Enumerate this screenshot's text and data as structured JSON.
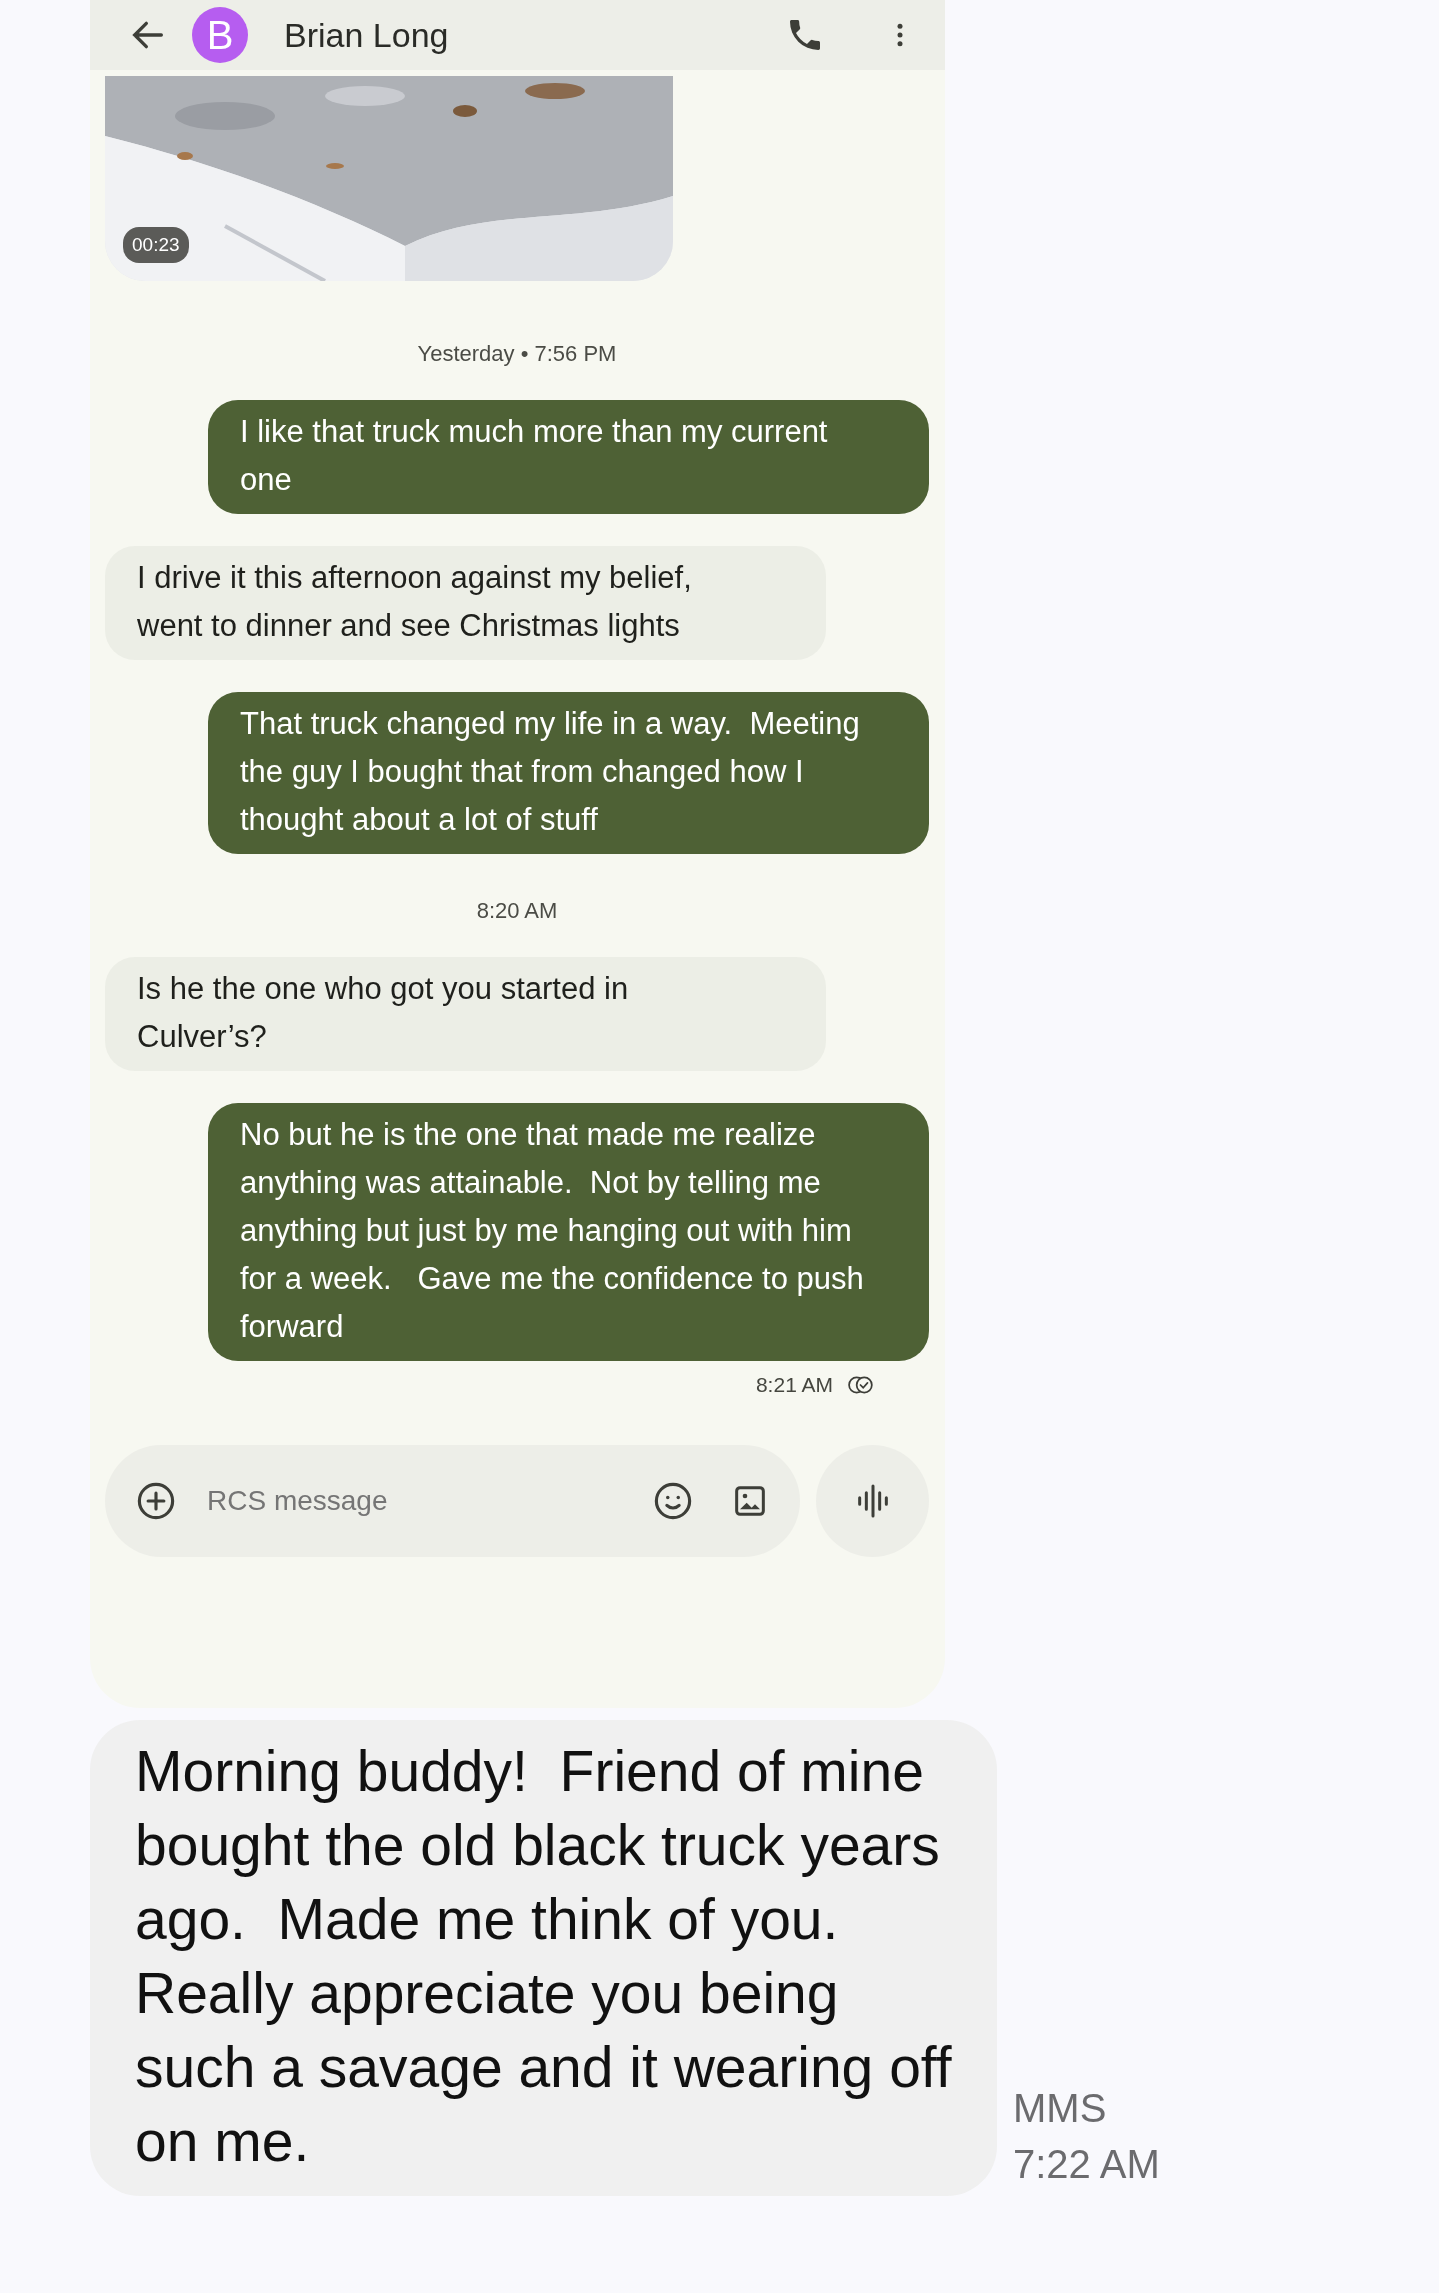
{
  "screenshot": {
    "header": {
      "avatar_letter": "B",
      "title": "Brian Long"
    },
    "video": {
      "kind": "picture",
      "duration": "00:23"
    },
    "messages": [
      {
        "kind": "timestamp",
        "text": "Yesterday • 7:56 PM"
      },
      {
        "kind": "sent",
        "text": "I like that truck much more than my current one"
      },
      {
        "kind": "received",
        "text": "I drive it this afternoon against my belief, went to dinner and see Christmas lights"
      },
      {
        "kind": "sent",
        "text": "That truck changed my life in a way.  Meeting the guy I bought that from changed how I thought about a lot of stuff"
      },
      {
        "kind": "timestamp",
        "text": "8:20 AM"
      },
      {
        "kind": "received",
        "text": "Is he the one who got you started in Culver’s?"
      },
      {
        "kind": "sent",
        "text": "No but he is the one that made me realize anything was attainable.  Not by telling me anything but just by me hanging out with him for a week.   Gave me the confidence to push forward"
      },
      {
        "kind": "status",
        "text": "8:21 AM"
      }
    ],
    "composer": {
      "placeholder": "RCS message"
    }
  },
  "message": {
    "text": "Morning buddy!  Friend of mine bought the old black truck years ago.  Made me think of you.  Really appreciate you being such a savage and it wearing off on me."
  },
  "meta": {
    "type": "MMS",
    "time": "7:22 AM"
  }
}
